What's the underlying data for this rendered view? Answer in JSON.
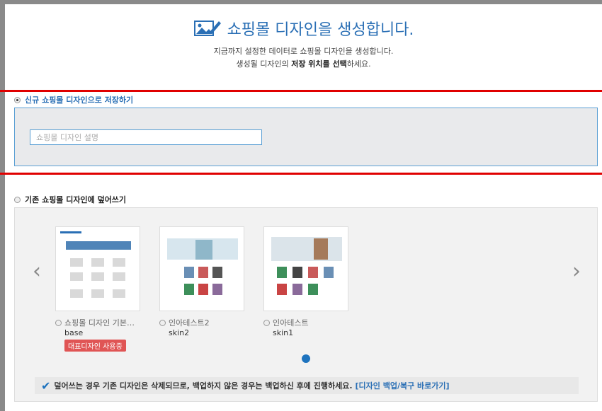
{
  "header": {
    "icon": "design-edit-icon",
    "title": "쇼핑몰 디자인을 생성합니다.",
    "desc_line1": "지금까지 설정한 데이터로 쇼핑몰 디자인을 생성합니다.",
    "desc_line2_pre": "생성될 디자인의 ",
    "desc_line2_bold": "저장 위치를 선택",
    "desc_line2_post": "하세요."
  },
  "option_new": {
    "label": "신규 쇼핑몰 디자인으로 저장하기",
    "selected": true,
    "input_placeholder": "쇼핑몰 디자인 설명",
    "input_value": ""
  },
  "option_overwrite": {
    "label": "기존 쇼핑몰 디자인에 덮어쓰기",
    "selected": false
  },
  "skins": [
    {
      "name": "쇼핑몰 디자인 기본…",
      "id": "base",
      "badge": "대표디자인 사용중"
    },
    {
      "name": "인아테스트2",
      "id": "skin2"
    },
    {
      "name": "인아테스트",
      "id": "skin1"
    }
  ],
  "carousel": {
    "prev": "‹",
    "next": "›",
    "page": 1
  },
  "notice": {
    "text": "덮어쓰는 경우 기존 디자인은 삭제되므로, 백업하지 않은 경우는 백업하신 후에 진행하세요.",
    "link": "[디자인 백업/복구 바로가기]"
  },
  "colors": {
    "accent": "#2a6fb5",
    "highlight_border": "#e00000",
    "badge": "#e05555",
    "pager_dot": "#1e73be"
  }
}
